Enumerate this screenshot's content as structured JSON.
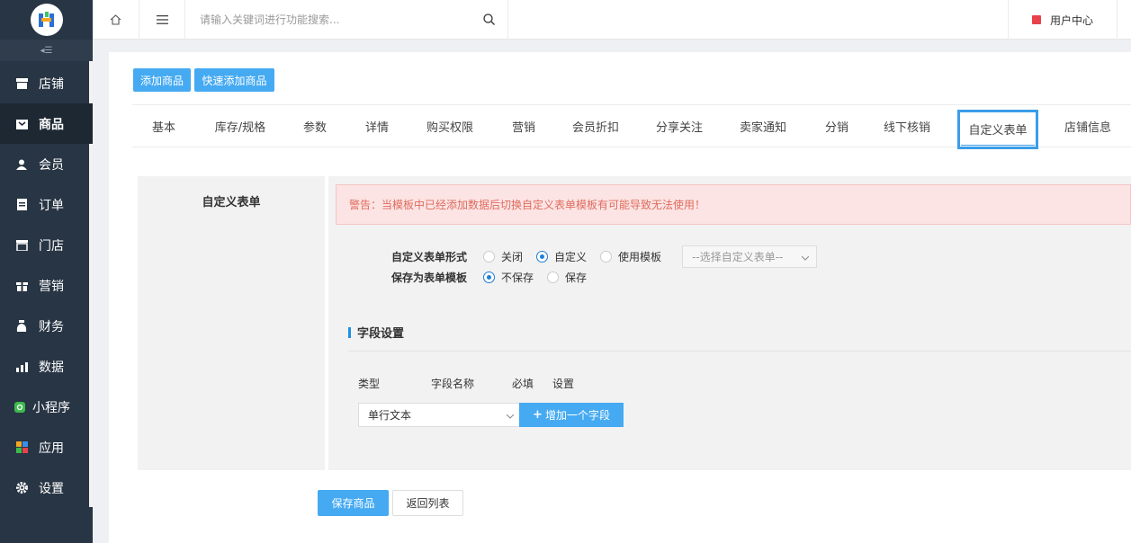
{
  "colors": {
    "sidebar_bg": "#283544",
    "accent": "#45aaf2",
    "warning_text": "#e06b5f",
    "warning_bg": "#fbe4e3"
  },
  "topbar": {
    "search_placeholder": "请输入关键词进行功能搜索...",
    "user_center": "用户中心"
  },
  "sidebar": {
    "items": [
      {
        "label": "店铺",
        "icon": "store-icon"
      },
      {
        "label": "商品",
        "icon": "goods-icon"
      },
      {
        "label": "会员",
        "icon": "member-icon"
      },
      {
        "label": "订单",
        "icon": "order-icon"
      },
      {
        "label": "门店",
        "icon": "shop-icon"
      },
      {
        "label": "营销",
        "icon": "gift-icon"
      },
      {
        "label": "财务",
        "icon": "finance-icon"
      },
      {
        "label": "数据",
        "icon": "chart-icon"
      },
      {
        "label": "小程序",
        "icon": "miniapp-icon"
      },
      {
        "label": "应用",
        "icon": "apps-icon"
      },
      {
        "label": "设置",
        "icon": "gear-icon"
      }
    ],
    "active": "商品"
  },
  "actions": {
    "add_goods": "添加商品",
    "quick_add_goods": "快速添加商品"
  },
  "tabs": [
    "基本",
    "库存/规格",
    "参数",
    "详情",
    "购买权限",
    "营销",
    "会员折扣",
    "分享关注",
    "卖家通知",
    "分销",
    "线下核销",
    "自定义表单",
    "店铺信息"
  ],
  "active_tab": "自定义表单",
  "section": {
    "title": "自定义表单",
    "warning": "警告：当模板中已经添加数据后切换自定义表单模板有可能导致无法使用！",
    "form_type": {
      "label": "自定义表单形式",
      "options": [
        "关闭",
        "自定义",
        "使用模板"
      ],
      "selected": "自定义",
      "template_select_placeholder": "--选择自定义表单--"
    },
    "save_template": {
      "label": "保存为表单模板",
      "options": [
        "不保存",
        "保存"
      ],
      "selected": "不保存"
    },
    "fields": {
      "title": "字段设置",
      "headers": [
        "类型",
        "字段名称",
        "必填",
        "设置"
      ],
      "type_value": "单行文本",
      "add_button": "增加一个字段"
    }
  },
  "footer": {
    "save": "保存商品",
    "back": "返回列表"
  }
}
